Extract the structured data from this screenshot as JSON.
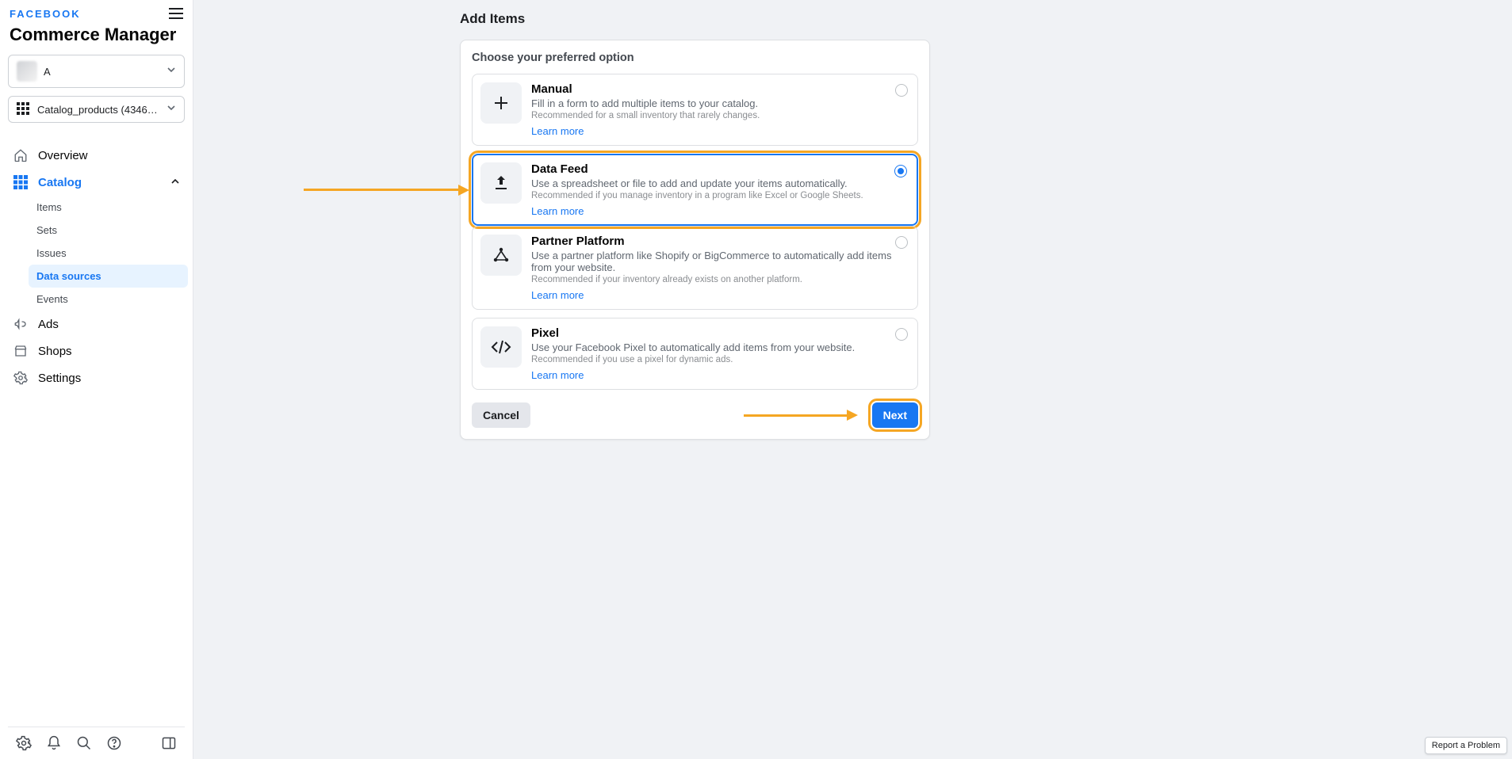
{
  "brand": "FACEBOOK",
  "product": "Commerce Manager",
  "account_selector": {
    "label": "A"
  },
  "catalog_selector": {
    "label": "Catalog_products (43461994..."
  },
  "nav": {
    "overview": "Overview",
    "catalog": "Catalog",
    "catalog_children": {
      "items": "Items",
      "sets": "Sets",
      "issues": "Issues",
      "data_sources": "Data sources",
      "events": "Events"
    },
    "ads": "Ads",
    "shops": "Shops",
    "settings": "Settings"
  },
  "page": {
    "title": "Add Items",
    "card_title": "Choose your preferred option",
    "options": {
      "manual": {
        "title": "Manual",
        "desc": "Fill in a form to add multiple items to your catalog.",
        "rec": "Recommended for a small inventory that rarely changes.",
        "link": "Learn more"
      },
      "data_feed": {
        "title": "Data Feed",
        "desc": "Use a spreadsheet or file to add and update your items automatically.",
        "rec": "Recommended if you manage inventory in a program like Excel or Google Sheets.",
        "link": "Learn more"
      },
      "partner": {
        "title": "Partner Platform",
        "desc": "Use a partner platform like Shopify or BigCommerce to automatically add items from your website.",
        "rec": "Recommended if your inventory already exists on another platform.",
        "link": "Learn more"
      },
      "pixel": {
        "title": "Pixel",
        "desc": "Use your Facebook Pixel to automatically add items from your website.",
        "rec": "Recommended if you use a pixel for dynamic ads.",
        "link": "Learn more"
      }
    },
    "cancel": "Cancel",
    "next": "Next"
  },
  "footer": {
    "report": "Report a Problem"
  }
}
